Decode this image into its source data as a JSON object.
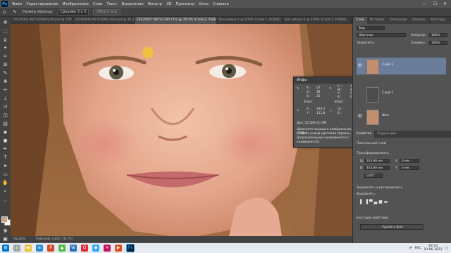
{
  "menubar": {
    "logo": "Ps",
    "items": [
      "Файл",
      "Редактирование",
      "Изображение",
      "Слои",
      "Текст",
      "Выделение",
      "Фильтр",
      "3D",
      "Просмотр",
      "Окно",
      "Справка"
    ],
    "controls": [
      "—",
      "☐",
      "✕"
    ]
  },
  "options": {
    "sample_label": "Размер образца:",
    "sample_value": "Среднее 3 х 3",
    "sample_btn": "Убрать все"
  },
  "tabs": [
    {
      "label": "20220301-667A2948-Edit.psd @ 100% (Слой 2, RGB/8) ×",
      "active": false
    },
    {
      "label": "20180806-667A3880-293.psd @ 30,2% (Слой 2, RGB/8) ×",
      "active": false
    },
    {
      "label": "20220427-667A1391.CR2 @ 78,2% (Слой 2, RGB/8) *",
      "active": true
    },
    {
      "label": "Без имени-2 @ 100% (Слой 1, RGB/8) ×",
      "active": false
    },
    {
      "label": "Без имени-3 @ 100% (Слой 1, RGB/8)",
      "active": false
    }
  ],
  "status": {
    "zoom": "78,22%",
    "doc": "Рабочий: 4,6/4; 76,75?"
  },
  "info_panel": {
    "title": "Инфо",
    "r": "R :",
    "g": "G :",
    "b": "B :",
    "rv": "67",
    "gv": "38",
    "bv": "25",
    "c": "C :",
    "m": "M :",
    "y": "Y :",
    "k": "K :",
    "cv": "15%",
    "mv": "47%",
    "yv": "53%",
    "kv": "0%",
    "bit_left": "8-бит",
    "bit_right": "8-бит",
    "x": "X :",
    "xv": "184,2",
    "yl": "Y :",
    "yv2": "111,8",
    "w": "Ш :",
    "h": "В :",
    "doc": "Док: 52,5М/157,4М",
    "hint1": "Щелкните мышью в изображении, чтобы",
    "hint2": "создать новый цветовой образец.",
    "hint3": "Дополнительные возможности с",
    "hint4": "клавишей Ctrl."
  },
  "layers_panel": {
    "tabs": [
      "Слои",
      "История",
      "Операции",
      "Каналы",
      "Контуры"
    ],
    "search": "Вид",
    "blend": "Обычные",
    "opacity_label": "Непрозр.:",
    "opacity_value": "100%",
    "lock_label": "Закрепить:",
    "fill_label": "Заливка:",
    "fill_value": "100%",
    "layers": [
      {
        "name": "Слой 2",
        "selected": true
      },
      {
        "name": "Слой 1",
        "selected": false
      },
      {
        "name": "Фон",
        "selected": false
      }
    ]
  },
  "props_panel": {
    "tabs": [
      "Свойства",
      "Коррекция"
    ],
    "kind": "Пиксельный слой",
    "transform": "Трансформировать",
    "w": "Ш",
    "wv": "205,99 мм",
    "x": "X",
    "xv": "0 мм",
    "h": "В",
    "hv": "443,89 мм",
    "y": "Y",
    "yv": "0 мм",
    "angle": "0,00°",
    "align": "Выровнять и распределить",
    "align_sub": "Выровнять:",
    "quick": "Быстрые действия",
    "remove_bg": "Удалить фон"
  },
  "taskbar": {
    "lang": "РУС",
    "time": "19:54",
    "date": "10.06.2022"
  },
  "colors": {
    "accent": "#31a8ff",
    "selected_layer": "#6a7d9a"
  }
}
